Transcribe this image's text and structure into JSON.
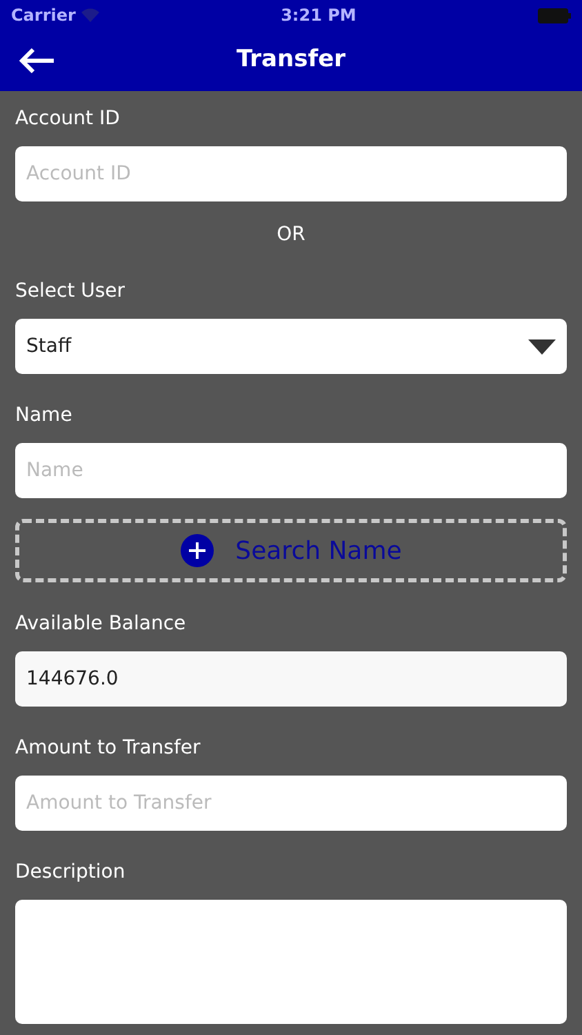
{
  "status_bar": {
    "carrier": "Carrier",
    "time": "3:21 PM"
  },
  "header": {
    "title": "Transfer"
  },
  "form": [
    {
      "kind": "field",
      "label": "Account ID",
      "placeholder": "Account ID"
    },
    {
      "kind": "separator",
      "text": "OR"
    },
    {
      "kind": "select",
      "label": "Select User",
      "value": "Staff"
    },
    {
      "kind": "field",
      "label": "Name",
      "placeholder": "Name"
    },
    {
      "kind": "button",
      "text": "Search Name"
    },
    {
      "kind": "field",
      "label": "Available Balance",
      "value": "144676.0"
    },
    {
      "kind": "field",
      "label": "Amount to Transfer",
      "placeholder": "Amount to Transfer"
    },
    {
      "kind": "textarea",
      "label": "Description"
    }
  ]
}
